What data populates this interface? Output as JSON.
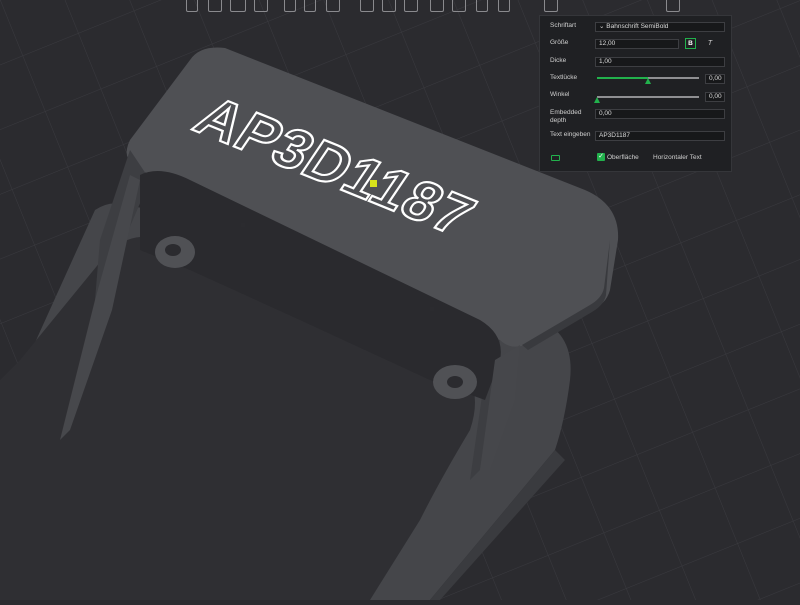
{
  "toolbar": {
    "icons": [
      "text-icon",
      "grid-icon",
      "sketch-icon",
      "layers-icon",
      "paint-icon",
      "cut-icon",
      "list-icon",
      "move-icon",
      "measure-icon",
      "view-icon",
      "assembly-icon",
      "support-icon",
      "seam-icon",
      "variable-layer-icon",
      "emboss-icon",
      "settings-icon"
    ]
  },
  "panel": {
    "font_label": "Schriftart",
    "font_value": "Bahnschrift SemiBold",
    "size_label": "Größe",
    "size_value": "12,00",
    "bold_label": "B",
    "italic_label": "T",
    "thickness_label": "Dicke",
    "thickness_value": "1,00",
    "gap_label": "Textlücke",
    "gap_value": "0,00",
    "gap_fraction": 0.5,
    "angle_label": "Winkel",
    "angle_value": "0,00",
    "angle_fraction": 0.0,
    "embedded_label_1": "Embedded",
    "embedded_label_2": "depth",
    "embedded_value": "0,00",
    "text_label": "Text eingeben",
    "text_value": "AP3D1187",
    "surface_label": "Oberfläche",
    "surface_checked": true,
    "horizontal_label": "Horizontaler Text",
    "horizontal_checked": false
  },
  "model": {
    "embossed_text": "AP3D1187"
  },
  "colors": {
    "accent": "#22b14c",
    "background": "#2b2b2f",
    "model": "#4f5054",
    "panel": "#1f2023",
    "highlight": "#d7e21a"
  }
}
